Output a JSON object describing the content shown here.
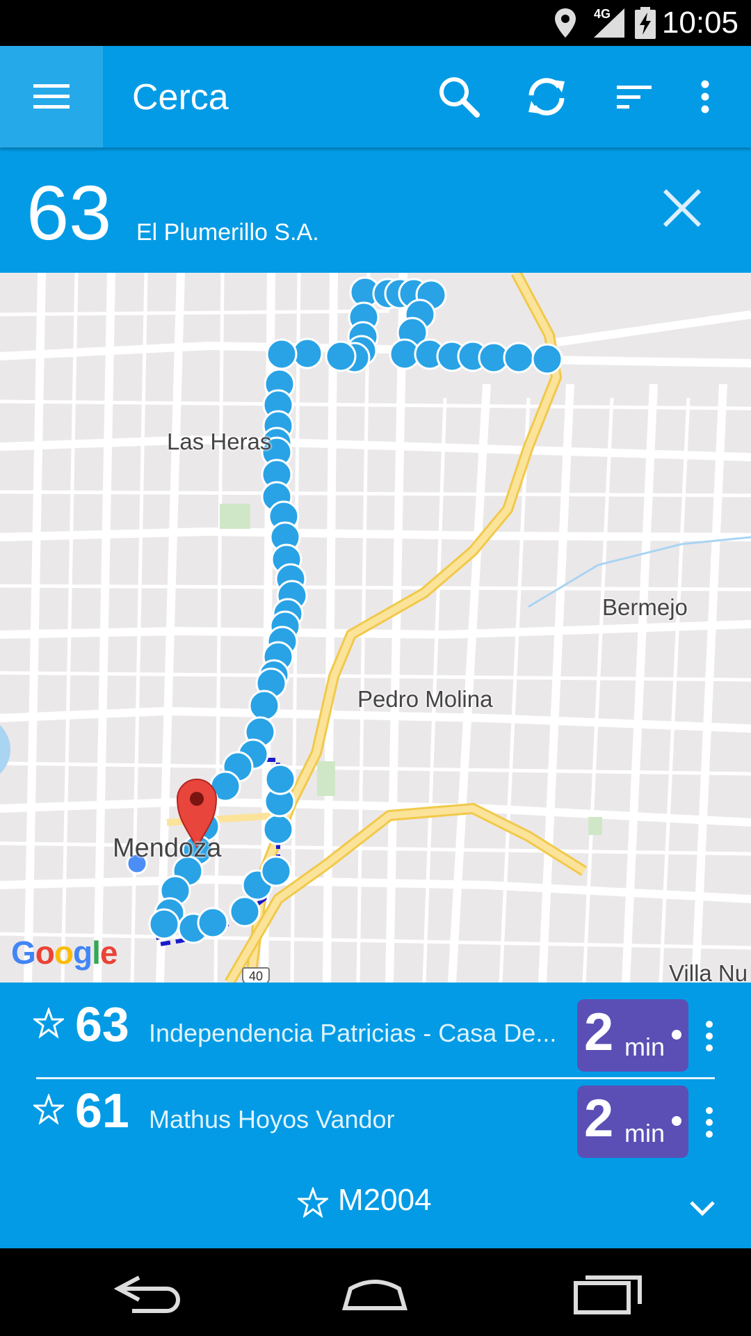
{
  "status_bar": {
    "network": "4G",
    "time": "10:05",
    "icons": [
      "location-icon",
      "signal-icon",
      "battery-charging-icon"
    ]
  },
  "app_bar": {
    "title": "Cerca",
    "actions": [
      "search-icon",
      "refresh-icon",
      "sort-icon",
      "more-vert-icon"
    ]
  },
  "route": {
    "number": "63",
    "company": "El Plumerillo S.A."
  },
  "map": {
    "labels": {
      "las_heras": "Las Heras",
      "bermejo": "Bermejo",
      "pedro_molina": "Pedro Molina",
      "mendoza": "Mendoza",
      "villa_nu": "Villa Nu"
    },
    "road_shield": "40",
    "attribution": "Google",
    "colors": {
      "stop": "#29a3e6",
      "route_line": "#1a1acc",
      "marker": "#e8453c",
      "highway": "#f8d77a"
    }
  },
  "arrivals": [
    {
      "line": "63",
      "destination": "Independencia Patricias - Casa De...",
      "eta": "2",
      "unit": "min"
    },
    {
      "line": "61",
      "destination": "Mathus Hoyos Vandor",
      "eta": "2",
      "unit": "min"
    }
  ],
  "stop": {
    "code": "M2004"
  },
  "theme": {
    "primary": "#039be5",
    "eta_bg": "#5b4fb6"
  }
}
